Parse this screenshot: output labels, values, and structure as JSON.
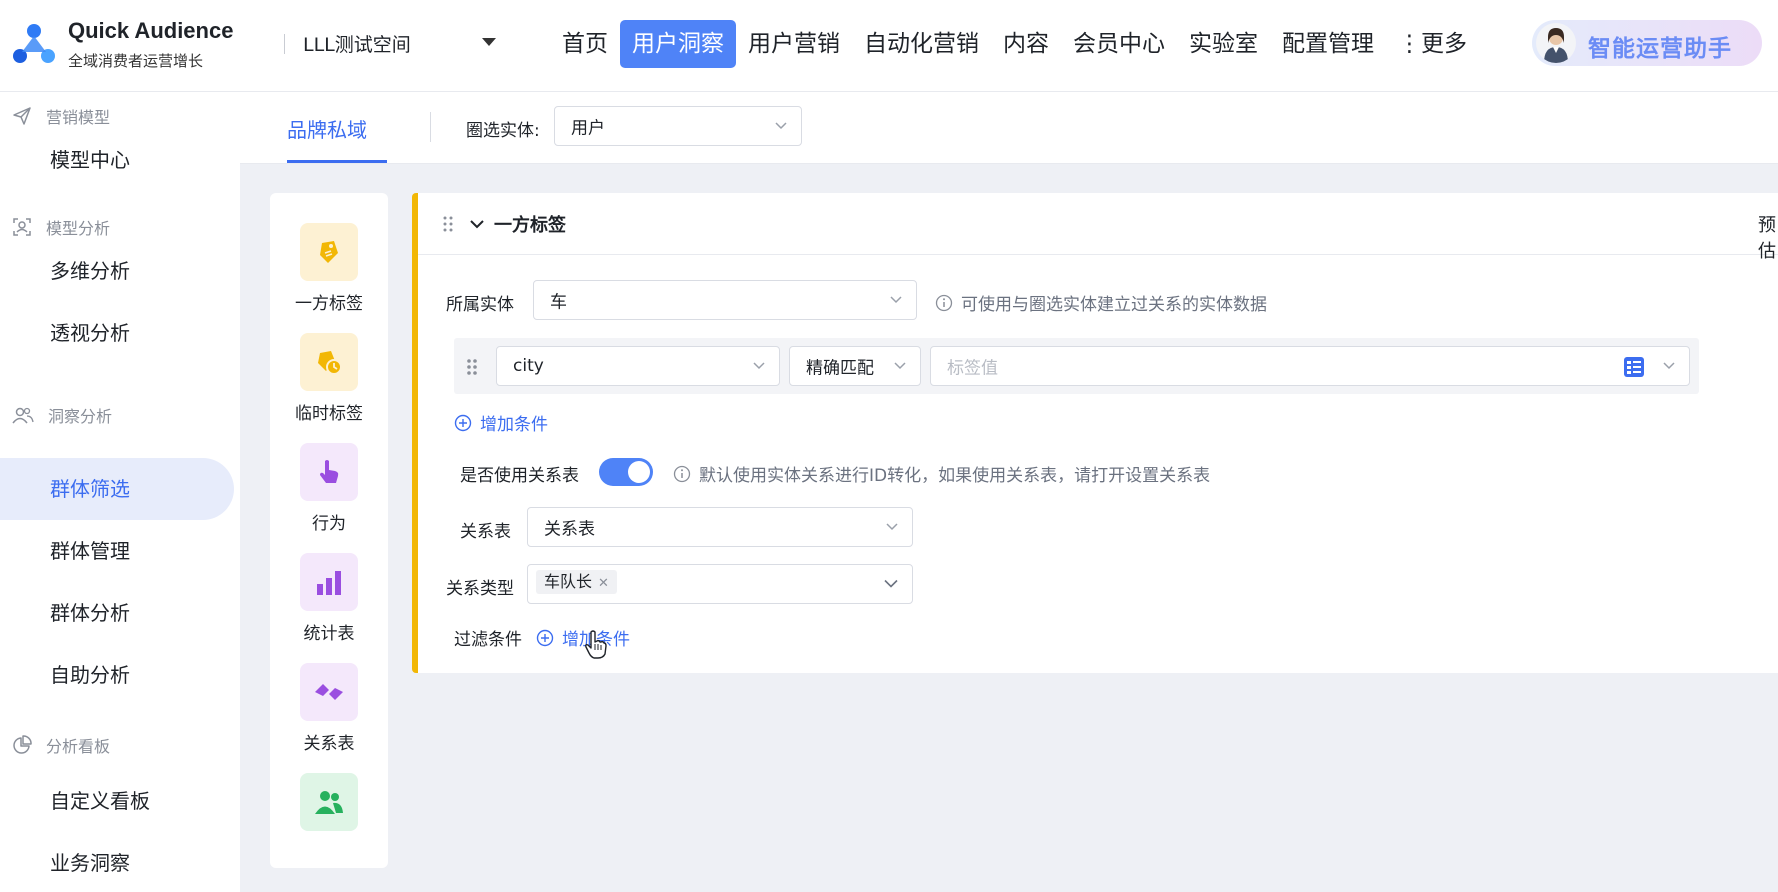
{
  "header": {
    "brand_name": "Quick Audience",
    "brand_sub": "全域消费者运营增长",
    "workspace": "LLL测试空间",
    "nav": [
      "首页",
      "用户洞察",
      "用户营销",
      "自动化营销",
      "内容",
      "会员中心",
      "实验室",
      "配置管理",
      "⋮更多"
    ],
    "nav_active_index": 1,
    "assistant_label": "智能运营助手"
  },
  "sidebar": {
    "groups": [
      {
        "title": "营销模型",
        "icon": "send-icon",
        "items": [
          "模型中心"
        ]
      },
      {
        "title": "模型分析",
        "icon": "user-frame-icon",
        "items": [
          "多维分析",
          "透视分析"
        ]
      },
      {
        "title": "洞察分析",
        "icon": "users-icon",
        "items": [
          "群体筛选",
          "群体管理",
          "群体分析",
          "自助分析"
        ]
      },
      {
        "title": "分析看板",
        "icon": "pie-chart-icon",
        "items": [
          "自定义看板",
          "业务洞察"
        ]
      }
    ],
    "active_item": "群体筛选"
  },
  "subheader": {
    "tab": "品牌私域",
    "filter_label": "圈选实体:",
    "filter_value": "用户"
  },
  "palette": [
    {
      "label": "一方标签",
      "icon": "tag-icon"
    },
    {
      "label": "临时标签",
      "icon": "temp-tag-icon"
    },
    {
      "label": "行为",
      "icon": "pointer-hand-icon"
    },
    {
      "label": "统计表",
      "icon": "bar-chart-icon"
    },
    {
      "label": "关系表",
      "icon": "link-icon"
    },
    {
      "label": "",
      "icon": "user-group-icon"
    }
  ],
  "card": {
    "title": "一方标签",
    "preview": "预估",
    "entity_label": "所属实体",
    "entity_value": "车",
    "entity_hint": "可使用与圈选实体建立过关系的实体数据",
    "condition": {
      "field": "city",
      "match": "精确匹配",
      "value_placeholder": "标签值"
    },
    "add_condition": "增加条件",
    "use_relation_label": "是否使用关系表",
    "use_relation_on": true,
    "use_relation_hint": "默认使用实体关系进行ID转化，如果使用关系表，请打开设置关系表",
    "relation_table_label": "关系表",
    "relation_table_value": "关系表",
    "relation_type_label": "关系类型",
    "relation_type_tag": "车队长",
    "filter_label": "过滤条件",
    "filter_add": "增加条件"
  },
  "colors": {
    "primary": "#3c6df0",
    "nav_active": "#4f83f7",
    "card_accent": "#f2b705"
  }
}
